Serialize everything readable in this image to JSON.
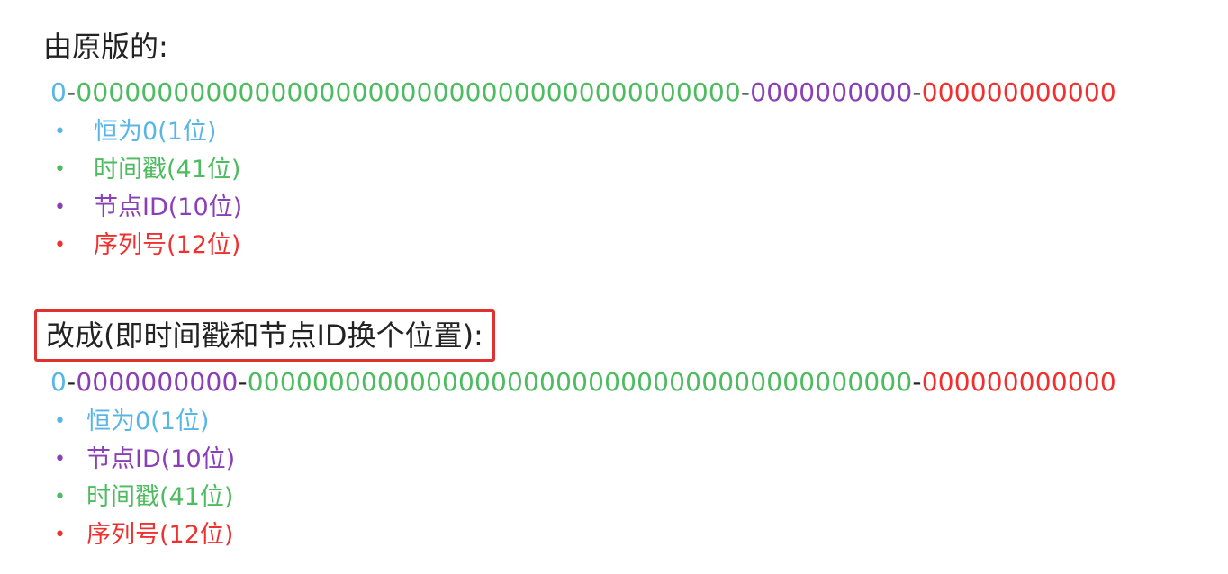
{
  "original": {
    "heading": "由原版的:",
    "bits": [
      {
        "text": "0",
        "type": "sign"
      },
      {
        "text": "-",
        "type": "sep"
      },
      {
        "text": "00000000000000000000000000000000000000000",
        "type": "time"
      },
      {
        "text": "-",
        "type": "sep"
      },
      {
        "text": "0000000000",
        "type": "node"
      },
      {
        "text": "-",
        "type": "sep"
      },
      {
        "text": "000000000000",
        "type": "seq"
      }
    ],
    "legend": [
      {
        "label": "恒为0(1位)",
        "type": "sign"
      },
      {
        "label": "时间戳(41位)",
        "type": "time"
      },
      {
        "label": "节点ID(10位)",
        "type": "node"
      },
      {
        "label": "序列号(12位)",
        "type": "seq"
      }
    ]
  },
  "modified": {
    "heading": "改成(即时间戳和节点ID换个位置):",
    "bits": [
      {
        "text": "0",
        "type": "sign"
      },
      {
        "text": "-",
        "type": "sep"
      },
      {
        "text": "0000000000",
        "type": "node"
      },
      {
        "text": "-",
        "type": "sep"
      },
      {
        "text": "00000000000000000000000000000000000000000",
        "type": "time"
      },
      {
        "text": "-",
        "type": "sep"
      },
      {
        "text": "000000000000",
        "type": "seq"
      }
    ],
    "legend": [
      {
        "label": "恒为0(1位)",
        "type": "sign"
      },
      {
        "label": "节点ID(10位)",
        "type": "node"
      },
      {
        "label": "时间戳(41位)",
        "type": "time"
      },
      {
        "label": "序列号(12位)",
        "type": "seq"
      }
    ]
  },
  "bullet_glyph": "•",
  "colors": {
    "sign": "#58b6e7",
    "time": "#4dbb5f",
    "node": "#8a3fb7",
    "seq": "#f0302e",
    "highlight_box": "#e03131"
  }
}
